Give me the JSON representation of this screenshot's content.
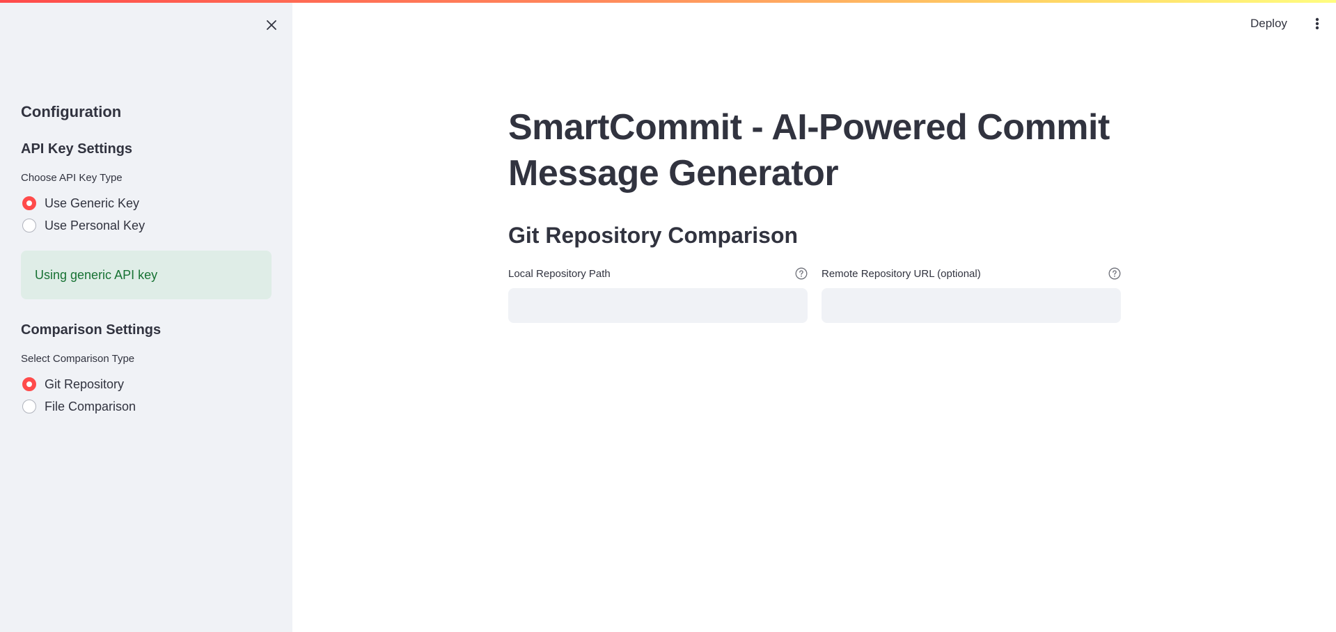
{
  "header": {
    "deploy_label": "Deploy",
    "menu_icon": "vertical-ellipsis-icon"
  },
  "sidebar": {
    "close_icon": "close-icon",
    "title": "Configuration",
    "api_section": {
      "heading": "API Key Settings",
      "radio_label": "Choose API Key Type",
      "options": [
        {
          "label": "Use Generic Key",
          "selected": true
        },
        {
          "label": "Use Personal Key",
          "selected": false
        }
      ],
      "info_message": "Using generic API key"
    },
    "comparison_section": {
      "heading": "Comparison Settings",
      "radio_label": "Select Comparison Type",
      "options": [
        {
          "label": "Git Repository",
          "selected": true
        },
        {
          "label": "File Comparison",
          "selected": false
        }
      ]
    }
  },
  "main": {
    "title": "SmartCommit - AI-Powered Commit Message Generator",
    "subtitle": "Git Repository Comparison",
    "fields": {
      "local_path": {
        "label": "Local Repository Path",
        "value": "",
        "placeholder": "",
        "help_icon": "help-circle-icon"
      },
      "remote_url": {
        "label": "Remote Repository URL (optional)",
        "value": "",
        "placeholder": "",
        "help_icon": "help-circle-icon"
      }
    }
  },
  "colors": {
    "accent": "#ff4b4b",
    "sidebar_bg": "#f0f2f6",
    "success_bg": "#dfede7",
    "success_text": "#177233",
    "text": "#31333f"
  }
}
